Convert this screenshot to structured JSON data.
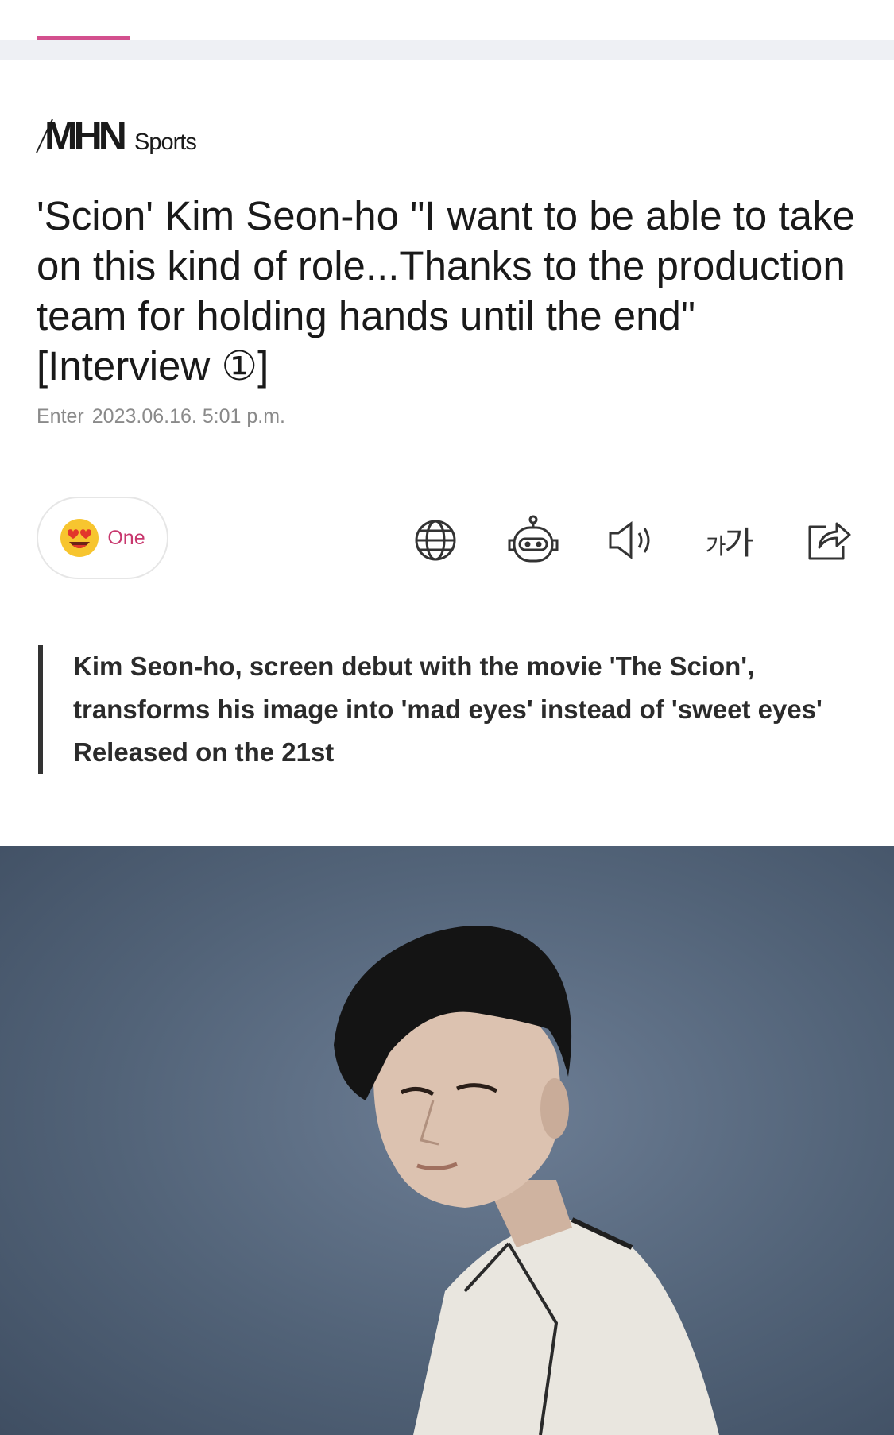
{
  "logo": {
    "main": "MHN",
    "sub": "Sports"
  },
  "article": {
    "headline": "'Scion' Kim Seon-ho \"I want to be able to take on this kind of role...Thanks to the production team for holding hands until the end\" [Interview ①]",
    "date_label": "Enter",
    "date_value": "2023.06.16. 5:01 p.m.",
    "subhead_lines": [
      "Kim Seon-ho, screen debut with the movie 'The Scion',",
      "transforms his image into 'mad eyes' instead of 'sweet eyes'",
      "Released on the 21st"
    ]
  },
  "reaction": {
    "icon": "heart-eyes-emoji-icon",
    "count": "One"
  },
  "toolbar": {
    "icons": [
      "globe-icon",
      "robot-icon",
      "speaker-icon",
      "font-size-icon",
      "share-icon"
    ],
    "font_label_small": "가",
    "font_label_large": "가"
  },
  "colors": {
    "accent": "#d3508e",
    "reaction_text": "#c8386e",
    "photo_bg": "#526378"
  }
}
